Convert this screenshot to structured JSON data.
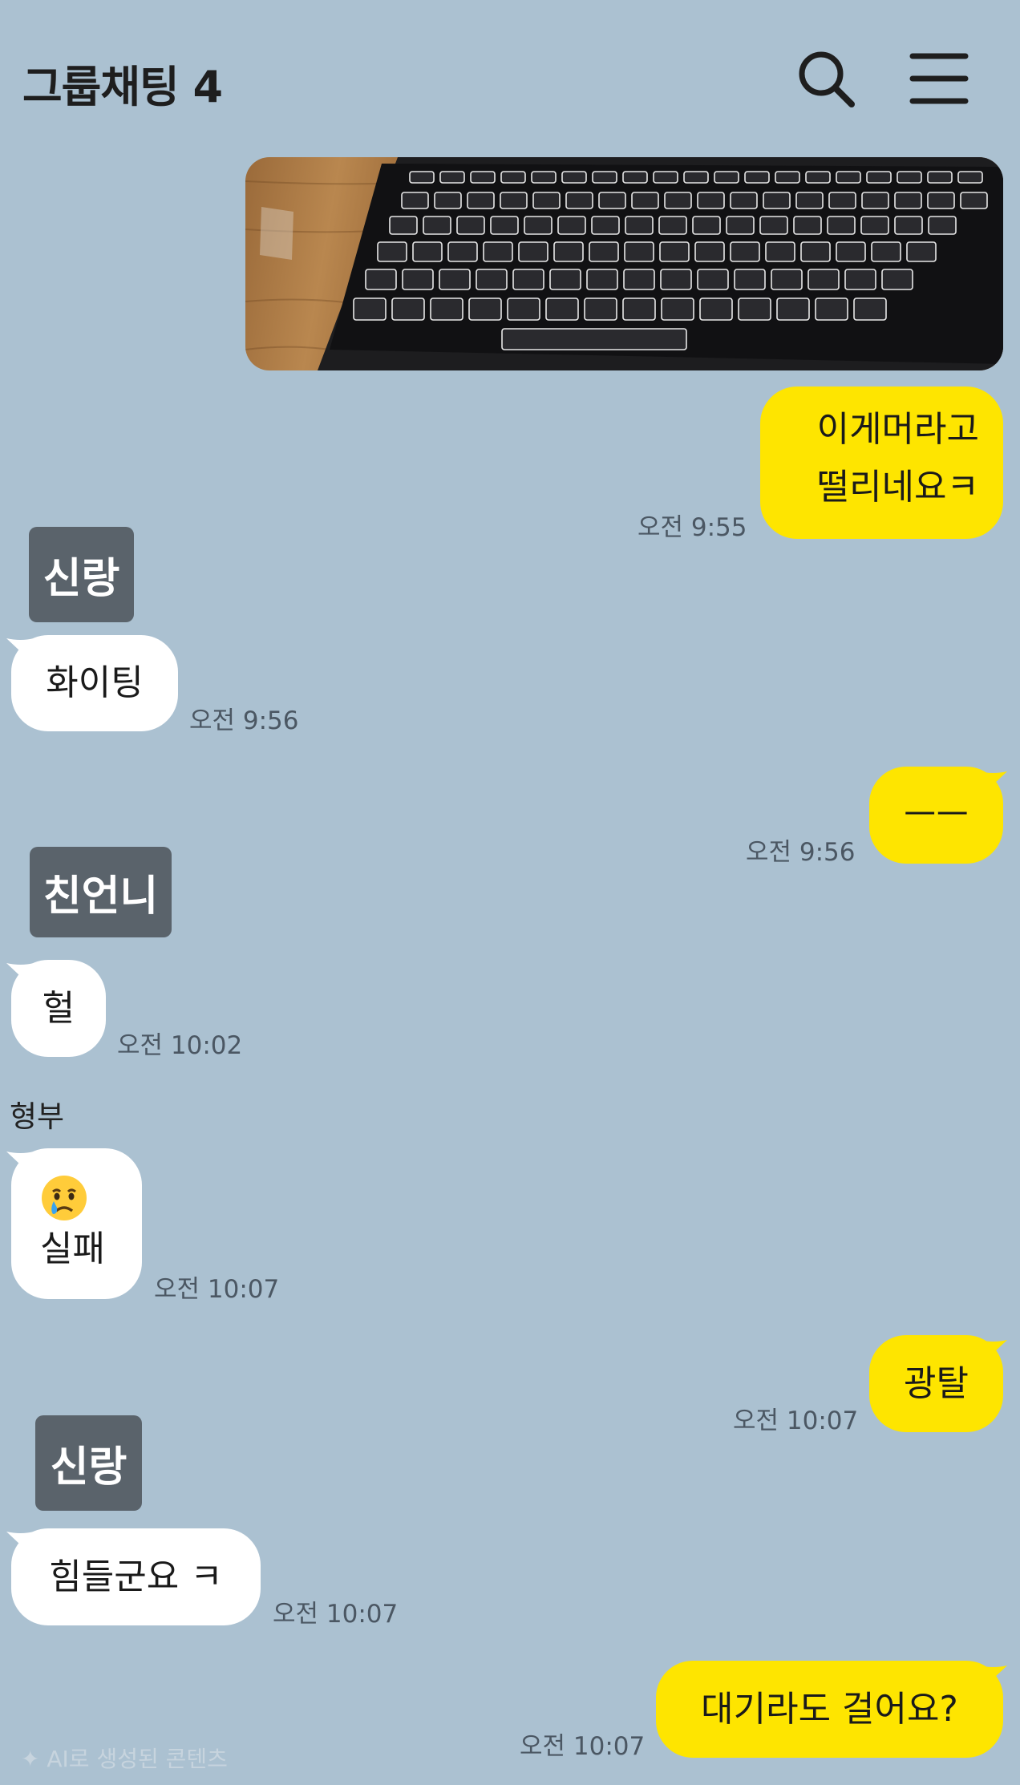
{
  "header": {
    "title": "그룹채팅 4",
    "search_icon": "search-icon",
    "menu_icon": "hamburger-menu-icon"
  },
  "colors": {
    "background": "#abc1d1",
    "my_bubble": "#fee500",
    "other_bubble": "#ffffff",
    "sender_badge": "#5a636b"
  },
  "messages": [
    {
      "type": "image",
      "from": "me",
      "image": "backlit-keyboard-photo"
    },
    {
      "from": "me",
      "line1": "이게머라고",
      "line2": "떨리네요ㅋ",
      "time": "오전 9:55"
    },
    {
      "sender": "신랑"
    },
    {
      "from": "other",
      "text": "화이팅",
      "time": "오전 9:56"
    },
    {
      "from": "me",
      "text": "ㅡㅡ",
      "time": "오전 9:56"
    },
    {
      "sender": "친언니"
    },
    {
      "from": "other",
      "text": "헐",
      "time": "오전 10:02"
    },
    {
      "sender": "형부"
    },
    {
      "from": "other",
      "emoji": "crying-face-emoji",
      "text": "실패",
      "time": "오전 10:07"
    },
    {
      "from": "me",
      "text": "광탈",
      "time": "오전 10:07"
    },
    {
      "sender": "신랑"
    },
    {
      "from": "other",
      "text": "힘들군요 ㅋ",
      "time": "오전 10:07"
    },
    {
      "from": "me",
      "text": "대기라도 걸어요?",
      "time": "오전 10:07"
    }
  ],
  "watermark": "AI로 생성된 콘텐츠"
}
